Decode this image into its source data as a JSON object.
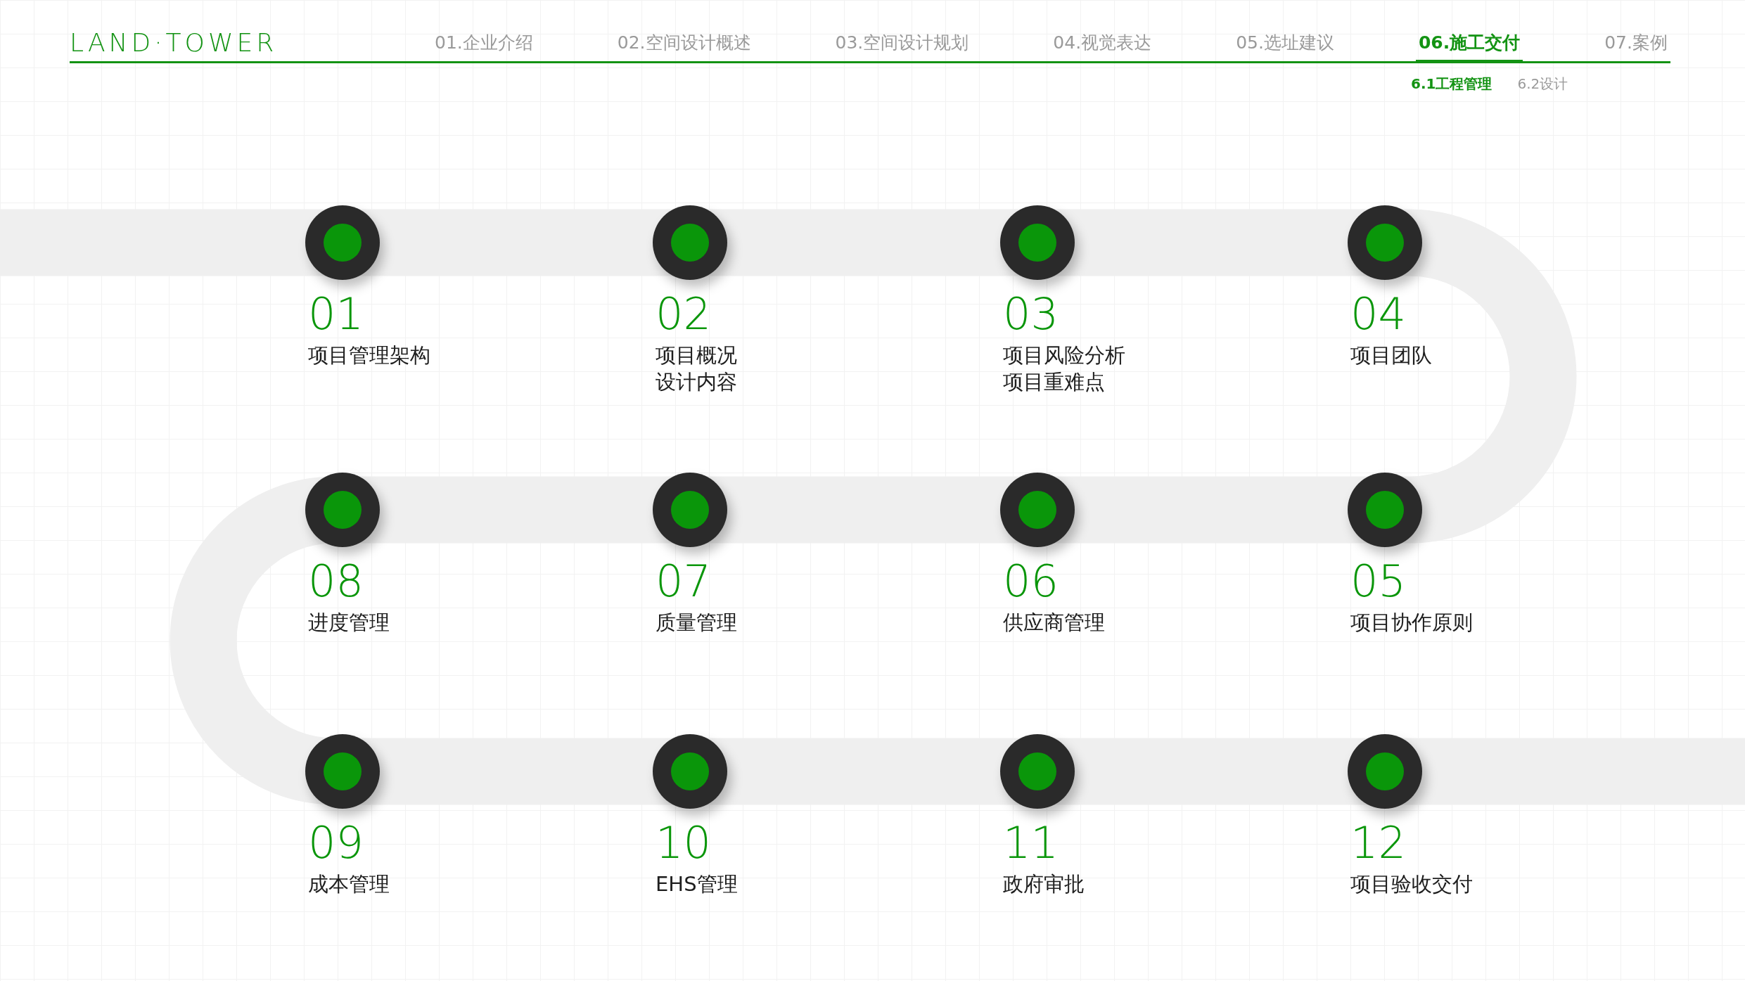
{
  "logo": "LAND·TOWER",
  "nav": [
    {
      "label": "01.企业介绍",
      "selected": false
    },
    {
      "label": "02.空间设计概述",
      "selected": false
    },
    {
      "label": "03.空间设计规划",
      "selected": false
    },
    {
      "label": "04.视觉表达",
      "selected": false
    },
    {
      "label": "05.选址建议",
      "selected": false
    },
    {
      "label": "06.施工交付",
      "selected": true
    },
    {
      "label": "07.案例",
      "selected": false
    }
  ],
  "subnav": [
    {
      "label": "6.1工程管理",
      "selected": true
    },
    {
      "label": "6.2设计",
      "selected": false
    }
  ],
  "steps": [
    {
      "number": "01",
      "lines": [
        "项目管理架构"
      ]
    },
    {
      "number": "02",
      "lines": [
        "项目概况",
        "设计内容"
      ]
    },
    {
      "number": "03",
      "lines": [
        "项目风险分析",
        "项目重难点"
      ]
    },
    {
      "number": "04",
      "lines": [
        "项目团队"
      ]
    },
    {
      "number": "08",
      "lines": [
        "进度管理"
      ]
    },
    {
      "number": "07",
      "lines": [
        "质量管理"
      ]
    },
    {
      "number": "06",
      "lines": [
        "供应商管理"
      ]
    },
    {
      "number": "05",
      "lines": [
        "项目协作原则"
      ]
    },
    {
      "number": "09",
      "lines": [
        "成本管理"
      ]
    },
    {
      "number": "10",
      "lines": [
        "EHS管理"
      ]
    },
    {
      "number": "11",
      "lines": [
        "政府审批"
      ]
    },
    {
      "number": "12",
      "lines": [
        "项目验收交付"
      ]
    }
  ]
}
